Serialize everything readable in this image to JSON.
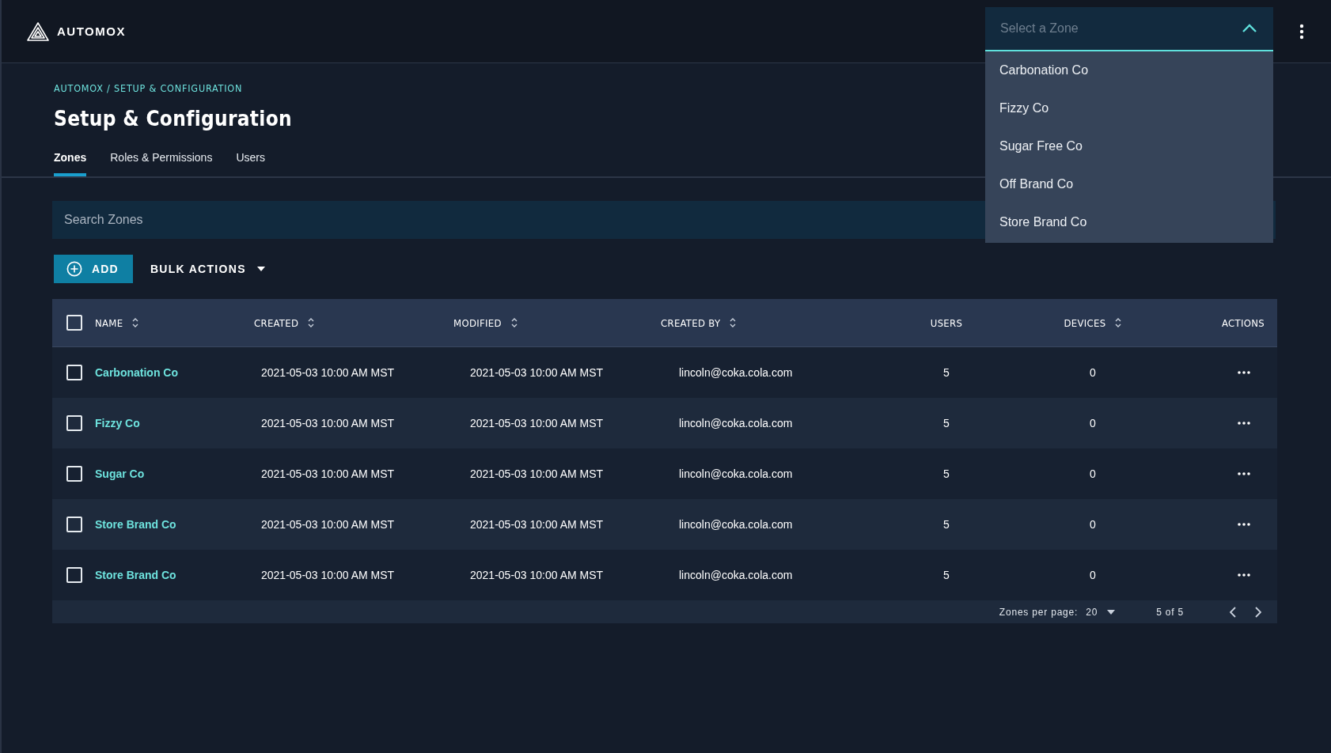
{
  "brand": {
    "name": "AUTOMOX"
  },
  "zone_select": {
    "placeholder": "Select a Zone",
    "expanded": true,
    "options": [
      "Carbonation Co",
      "Fizzy Co",
      "Sugar Free Co",
      "Off Brand Co",
      "Store Brand Co"
    ]
  },
  "breadcrumb": "AUTOMOX / SETUP & CONFIGURATION",
  "title": "Setup & Configuration",
  "tabs": [
    {
      "label": "Zones",
      "selected": true
    },
    {
      "label": "Roles & Permissions",
      "selected": false
    },
    {
      "label": "Users",
      "selected": false
    }
  ],
  "search": {
    "placeholder": "Search Zones"
  },
  "toolbar": {
    "add": "ADD",
    "bulk": "BULK ACTIONS"
  },
  "table": {
    "select_all_checked": false,
    "columns": [
      {
        "label": "NAME",
        "sortable": true
      },
      {
        "label": "CREATED",
        "sortable": true
      },
      {
        "label": "MODIFIED",
        "sortable": true
      },
      {
        "label": "CREATED BY",
        "sortable": true
      },
      {
        "label": "USERS",
        "sortable": false
      },
      {
        "label": "DEVICES",
        "sortable": true
      },
      {
        "label": "ACTIONS",
        "sortable": false
      }
    ],
    "rows": [
      {
        "checked": false,
        "name": "Carbonation Co",
        "created": "2021-05-03 10:00 AM MST",
        "modified": "2021-05-03 10:00 AM MST",
        "created_by": "lincoln@coka.cola.com",
        "users": "5",
        "devices": "0"
      },
      {
        "checked": false,
        "name": "Fizzy Co",
        "created": "2021-05-03 10:00 AM MST",
        "modified": "2021-05-03 10:00 AM MST",
        "created_by": "lincoln@coka.cola.com",
        "users": "5",
        "devices": "0"
      },
      {
        "checked": false,
        "name": "Sugar Co",
        "created": "2021-05-03 10:00 AM MST",
        "modified": "2021-05-03 10:00 AM MST",
        "created_by": "lincoln@coka.cola.com",
        "users": "5",
        "devices": "0"
      },
      {
        "checked": false,
        "name": "Store Brand Co",
        "created": "2021-05-03 10:00 AM MST",
        "modified": "2021-05-03 10:00 AM MST",
        "created_by": "lincoln@coka.cola.com",
        "users": "5",
        "devices": "0"
      },
      {
        "checked": false,
        "name": "Store Brand Co",
        "created": "2021-05-03 10:00 AM MST",
        "modified": "2021-05-03 10:00 AM MST",
        "created_by": "lincoln@coka.cola.com",
        "users": "5",
        "devices": "0"
      }
    ]
  },
  "pagination": {
    "label": "Zones per page:",
    "per_page": "20",
    "range": "5 of 5"
  }
}
